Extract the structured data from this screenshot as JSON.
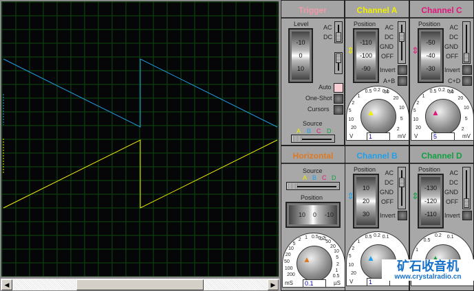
{
  "colors": {
    "trace_a": "#f0f000",
    "trace_b": "#1fa0e8",
    "trace_c": "#e0187a",
    "trace_d": "#10a040",
    "grid": "#0e4a0e",
    "trigger": "#f09aa8",
    "horizontal": "#e07820"
  },
  "trigger": {
    "title": "Trigger",
    "level_label": "Level",
    "level_ticks": [
      "-10",
      "0",
      "10"
    ],
    "coupling": [
      "AC",
      "DC"
    ],
    "auto": "Auto",
    "one_shot": "One-Shot",
    "cursors": "Cursors",
    "source_label": "Source",
    "sources": [
      "A",
      "B",
      "C",
      "D"
    ]
  },
  "channel_a": {
    "title": "Channel A",
    "position_label": "Position",
    "ticks": [
      "-110",
      "-100",
      "-90"
    ],
    "coupling": [
      "AC",
      "DC",
      "GND",
      "OFF"
    ],
    "invert": "Invert",
    "combine": "A+B",
    "volts_value": "1",
    "unit_v": "V",
    "unit_mv": "mV",
    "dial_v": [
      "20",
      "10",
      "5",
      "2",
      "1",
      "0.5",
      "0.2",
      "0.1"
    ],
    "dial_mv": [
      "50",
      "20",
      "10",
      "5",
      "2"
    ]
  },
  "channel_c": {
    "title": "Channel C",
    "position_label": "Position",
    "ticks": [
      "-50",
      "-40",
      "-30"
    ],
    "coupling": [
      "AC",
      "DC",
      "GND",
      "OFF"
    ],
    "invert": "Invert",
    "combine": "C+D",
    "volts_value": "5",
    "unit_v": "V",
    "unit_mv": "mV",
    "dial_v": [
      "20",
      "10",
      "5",
      "2",
      "1",
      "0.5",
      "0.2",
      "0.1"
    ],
    "dial_mv": [
      "50",
      "20",
      "10",
      "5",
      "2"
    ]
  },
  "horizontal": {
    "title": "Horizontal",
    "source_label": "Source",
    "sources": [
      "A",
      "B",
      "C",
      "D"
    ],
    "position_label": "Position",
    "ticks": [
      "10",
      "0",
      "-10"
    ],
    "time_value": "0.1",
    "unit_ms": "mS",
    "unit_us": "µS",
    "dial_ms": [
      "200",
      "100",
      "50",
      "20",
      "10",
      "5",
      "2",
      "1",
      "0.5",
      "0.2"
    ],
    "dial_us": [
      "0.1",
      "50",
      "20",
      "10",
      "5",
      "2",
      "1",
      "0.5"
    ]
  },
  "channel_b": {
    "title": "Channel B",
    "position_label": "Position",
    "ticks": [
      "10",
      "20",
      "30"
    ],
    "coupling": [
      "AC",
      "DC",
      "GND",
      "OFF"
    ],
    "invert": "Invert",
    "volts_value": "1",
    "unit_v": "V",
    "dial_v": [
      "20",
      "10",
      "5",
      "2",
      "1",
      "0.5",
      "0.2",
      "0.1"
    ]
  },
  "channel_d": {
    "title": "Channel D",
    "position_label": "Position",
    "ticks": [
      "-130",
      "-120",
      "-110"
    ],
    "coupling": [
      "AC",
      "DC",
      "GND",
      "OFF"
    ],
    "invert": "Invert",
    "dial_v": [
      "5",
      "2",
      "1",
      "0.5",
      "0.2",
      "0.1"
    ]
  },
  "watermark": {
    "title": "矿石收音机",
    "url": "www.crystalradio.cn"
  }
}
